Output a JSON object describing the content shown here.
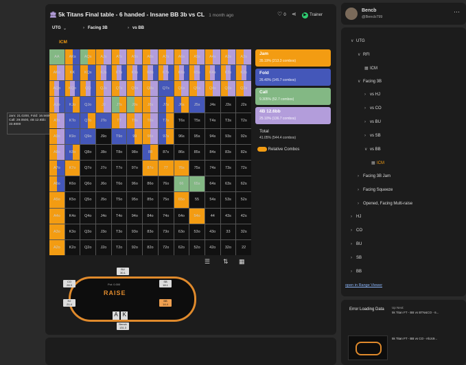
{
  "header": {
    "title": "5k Titans Final table - 6 handed - Insane BB 3b vs CL",
    "time_ago": "1 month ago",
    "likes": "0",
    "trainer_label": "Trainer"
  },
  "crumbs": {
    "pos": "UTG",
    "facing": "Facing 3B",
    "vs": "vs BB"
  },
  "icm_label": "ICM",
  "grid": {
    "labels": [
      [
        "AA",
        "AKs",
        "AQs",
        "AJs",
        "ATs",
        "A9s",
        "A8s",
        "A7s",
        "A6s",
        "A5s",
        "A4s",
        "A3s",
        "A2s"
      ],
      [
        "AKo",
        "KK",
        "KQs",
        "KJs",
        "KTs",
        "K9s",
        "K8s",
        "K7s",
        "K6s",
        "K5s",
        "K4s",
        "K3s",
        "K2s"
      ],
      [
        "AQo",
        "KQo",
        "QQ",
        "QJs",
        "QTs",
        "Q9s",
        "Q8s",
        "Q7s",
        "Q6s",
        "Q5s",
        "Q4s",
        "Q3s",
        "Q2s"
      ],
      [
        "AJo",
        "KJo",
        "QJo",
        "JJ",
        "JTs",
        "J9s",
        "J8s",
        "J7s",
        "J6s",
        "J5s",
        "J4s",
        "J3s",
        "J2s"
      ],
      [
        "ATo",
        "KTo",
        "QTo",
        "JTo",
        "TT",
        "T9s",
        "T8s",
        "T7s",
        "T6s",
        "T5s",
        "T4s",
        "T3s",
        "T2s"
      ],
      [
        "A9o",
        "K9o",
        "Q9o",
        "J9o",
        "T9o",
        "99",
        "98s",
        "97s",
        "96s",
        "95s",
        "94s",
        "93s",
        "92s"
      ],
      [
        "A8o",
        "K8o",
        "Q8o",
        "J8o",
        "T8o",
        "98o",
        "88",
        "87s",
        "86s",
        "85s",
        "84s",
        "83s",
        "82s"
      ],
      [
        "A7o",
        "K7o",
        "Q7o",
        "J7o",
        "T7o",
        "97o",
        "87o",
        "77",
        "76s",
        "75s",
        "74s",
        "73s",
        "72s"
      ],
      [
        "A6o",
        "K6o",
        "Q6o",
        "J6o",
        "T6o",
        "96o",
        "86o",
        "76o",
        "66",
        "65s",
        "64s",
        "63s",
        "62s"
      ],
      [
        "A5o",
        "K5o",
        "Q5o",
        "J5o",
        "T5o",
        "95o",
        "85o",
        "75o",
        "65o",
        "55",
        "54s",
        "53s",
        "52s"
      ],
      [
        "A4o",
        "K4o",
        "Q4o",
        "J4o",
        "T4o",
        "94o",
        "84o",
        "74o",
        "64o",
        "54o",
        "44",
        "43s",
        "42s"
      ],
      [
        "A3o",
        "K3o",
        "Q3o",
        "J3o",
        "T3o",
        "93o",
        "83o",
        "73o",
        "63o",
        "53o",
        "43o",
        "33",
        "32s"
      ],
      [
        "A2o",
        "K2o",
        "Q2o",
        "J2o",
        "T2o",
        "92o",
        "82o",
        "72o",
        "62o",
        "52o",
        "42o",
        "32o",
        "22"
      ]
    ]
  },
  "colors": {
    "jam": "#f39c12",
    "fold": "#4457b9",
    "call": "#83b884",
    "r4b": "#b39ddb",
    "empty": "#111111"
  },
  "legend": [
    {
      "label": "Jam",
      "sub": "35.19% (213.3 combos)",
      "color": "#f39c12"
    },
    {
      "label": "Fold",
      "sub": "26.40% (145.7 combos)",
      "color": "#4457b9"
    },
    {
      "label": "Call",
      "sub": "9.305% (52.7 combos)",
      "color": "#83b884"
    },
    {
      "label": "4B 12.6bb",
      "sub": "25.10% (136.7 combos)",
      "color": "#b39ddb"
    }
  ],
  "total": {
    "label": "Total",
    "value": "41.05% (544.4 combos)"
  },
  "relative_combos": "Relative Combos",
  "tooltip": [
    "Jam: 21.0200, Fold: 16.5600,",
    "Call: 29.0500, 4B 12.6bb:",
    "33.8800"
  ],
  "table": {
    "logo": "RAISE",
    "seats": [
      {
        "name": "BU",
        "stack": "30.1"
      },
      {
        "name": "CO",
        "stack": "28.3"
      },
      {
        "name": "HJ",
        "stack": "21.4"
      },
      {
        "name": "SB",
        "stack": "18.1"
      },
      {
        "name": "BB",
        "stack": "14.4"
      }
    ],
    "hero": {
      "name": "Bencb",
      "stack": "131.3",
      "cards": [
        "A",
        "K"
      ]
    },
    "pot": "Pot: 0.000"
  },
  "profile": {
    "name": "Bencb",
    "handle": "@Bencb799"
  },
  "tree": [
    {
      "label": "UTG",
      "indent": 0,
      "chev": "∨"
    },
    {
      "label": "RFI",
      "indent": 1,
      "chev": "∨"
    },
    {
      "label": "ICM",
      "indent": 2,
      "chev": "▦"
    },
    {
      "label": "Facing 3B",
      "indent": 1,
      "chev": "∨"
    },
    {
      "label": "vs HJ",
      "indent": 2,
      "chev": "›"
    },
    {
      "label": "vs CO",
      "indent": 2,
      "chev": "›"
    },
    {
      "label": "vs BU",
      "indent": 2,
      "chev": "›"
    },
    {
      "label": "vs SB",
      "indent": 2,
      "chev": "›"
    },
    {
      "label": "vs BB",
      "indent": 2,
      "chev": "∨"
    },
    {
      "label": "ICM",
      "indent": 3,
      "chev": "▦"
    },
    {
      "label": "Facing 3B Jam",
      "indent": 1,
      "chev": "›"
    },
    {
      "label": "Facing Squeeze",
      "indent": 1,
      "chev": "›"
    },
    {
      "label": "Opened, Facing Multi-raise",
      "indent": 1,
      "chev": "›"
    },
    {
      "label": "HJ",
      "indent": 0,
      "chev": "›"
    },
    {
      "label": "CO",
      "indent": 0,
      "chev": "›"
    },
    {
      "label": "BU",
      "indent": 0,
      "chev": "›"
    },
    {
      "label": "SB",
      "indent": 0,
      "chev": "›"
    },
    {
      "label": "BB",
      "indent": 0,
      "chev": "›"
    }
  ],
  "open_range_viewer": "open in Range Viewer",
  "feed": {
    "error": "Error Loading Data",
    "up_next": "Up Next:",
    "item1": "5k Titan FT - BB vs BTN&CO - 6...",
    "item2": "5k Titan FT - BB vs CO - AhJc9..."
  }
}
